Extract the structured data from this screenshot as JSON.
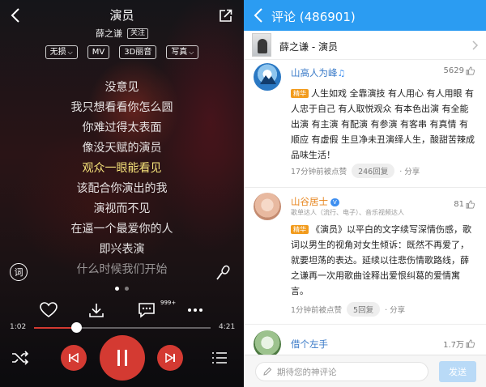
{
  "player": {
    "title": "演员",
    "artist": "薛之谦",
    "follow_label": "关注",
    "badges": [
      {
        "label": "无损",
        "has_dropdown": true
      },
      {
        "label": "MV",
        "has_dropdown": false
      },
      {
        "label": "3D丽音",
        "has_dropdown": false
      },
      {
        "label": "写真",
        "has_dropdown": true
      }
    ],
    "lyrics": [
      {
        "text": "没意见",
        "state": "normal"
      },
      {
        "text": "我只想看看你怎么圆",
        "state": "normal"
      },
      {
        "text": "你难过得太表面",
        "state": "normal"
      },
      {
        "text": "像没天赋的演员",
        "state": "normal"
      },
      {
        "text": "观众一眼能看见",
        "state": "active"
      },
      {
        "text": "该配合你演出的我",
        "state": "normal"
      },
      {
        "text": "演视而不见",
        "state": "normal"
      },
      {
        "text": "在逼一个最爱你的人",
        "state": "normal"
      },
      {
        "text": "即兴表演",
        "state": "normal"
      },
      {
        "text": "什么时候我们开始",
        "state": "dim"
      }
    ],
    "lyric_icon_label": "词",
    "page_dots": 2,
    "page_dot_active": 0,
    "comment_count_badge": "999+",
    "time_current": "1:02",
    "time_total": "4:21",
    "progress_fraction": 0.24,
    "colors": {
      "accent": "#d43a32",
      "highlight_lyric": "#f5e27a"
    },
    "icons": [
      "back-icon",
      "share-icon",
      "heart-icon",
      "download-icon",
      "comment-icon",
      "more-icon",
      "shuffle-icon",
      "prev-icon",
      "pause-icon",
      "next-icon",
      "playlist-icon",
      "microphone-icon"
    ]
  },
  "comments": {
    "header_title": "评论 (486901)",
    "song_label": "薛之谦 - 演员",
    "items": [
      {
        "user": "山高人为峰",
        "user_color": "#3b7bc8",
        "likes": "5629",
        "tag": "精华",
        "text": "人生如戏 全靠演技 有人用心 有人用眼 有人忠于自己 有人取悦观众 有本色出演 有全能出演 有主演 有配演 有参演 有客串 有真情 有顺应 有虚假 生旦净未丑演绎人生，酸甜苦辣成品味生活！",
        "time": "17分钟前被点赞",
        "replies": "246回复",
        "share": "分享"
      },
      {
        "user": "山谷居士",
        "user_color": "#e7861f",
        "vip_label": "V",
        "subtitle": "歌单达人（流行、电子）、音乐视频达人",
        "likes": "81",
        "tag": "精华",
        "text": "《演员》以平白的文字续写深情伤感，歌词以男生的视角对女生倾诉：既然不再爱了，就要坦荡的表达。延续以往悲伤情歌路线，薛之谦再一次用歌曲诠释出爱恨纠葛的爱情寓言。",
        "time": "1分钟前被点赞",
        "replies": "5回复",
        "share": "分享"
      },
      {
        "user": "借个左手",
        "user_color": "#3b7bc8",
        "likes": "1.7万"
      }
    ],
    "input_placeholder": "期待您的神评论",
    "send_label": "发送",
    "colors": {
      "header": "#2b9cf2",
      "send_disabled": "#b9daf7",
      "tag": "#f29b1c"
    }
  }
}
